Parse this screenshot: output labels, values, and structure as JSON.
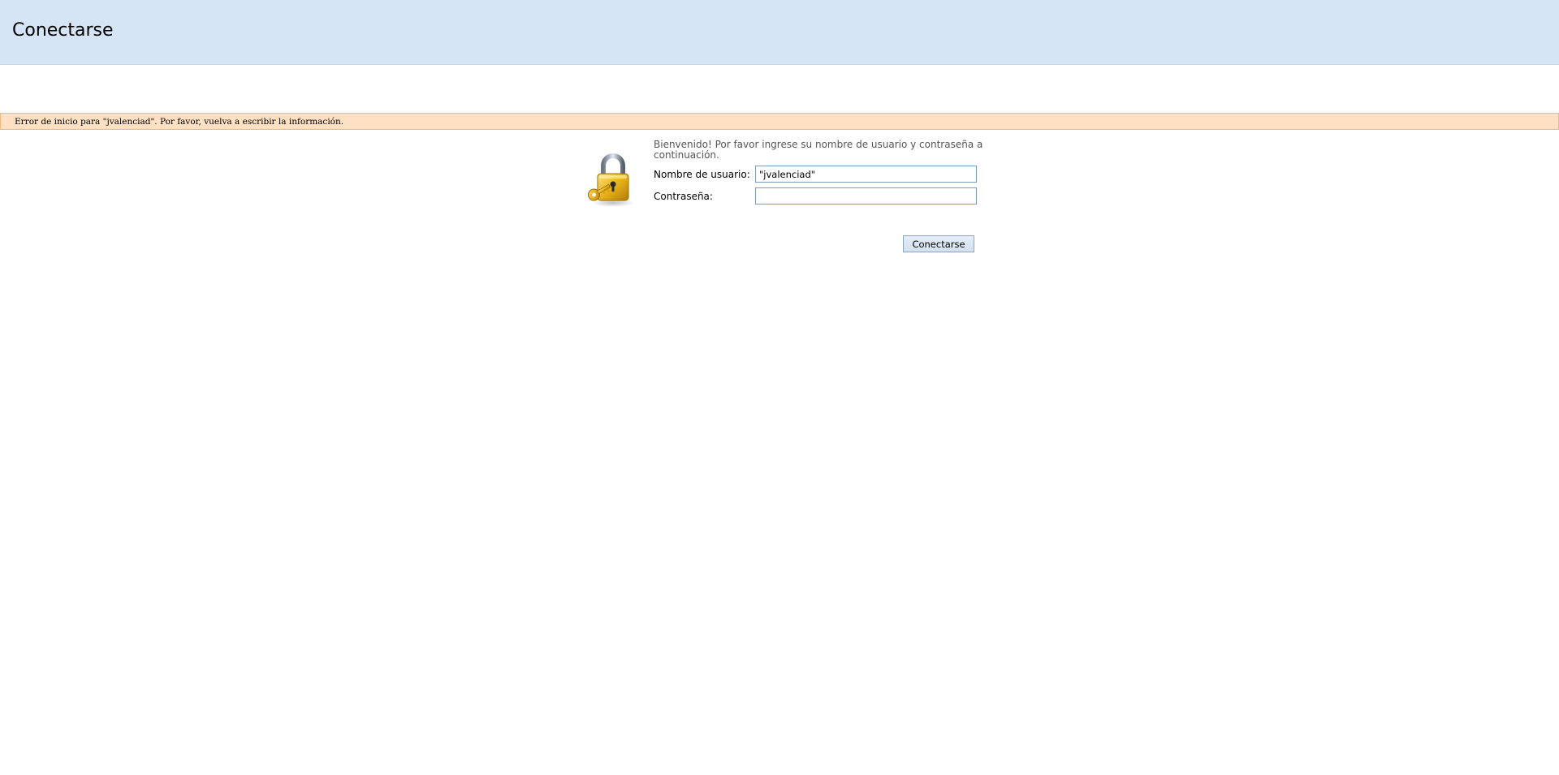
{
  "header": {
    "title": "Conectarse"
  },
  "error": {
    "message": "Error de inicio para \"jvalenciad\". Por favor, vuelva a escribir la información."
  },
  "login": {
    "welcome": "Bienvenido! Por favor ingrese su nombre de usuario y contraseña a continuación.",
    "username_label": "Nombre de usuario:",
    "username_value": "\"jvalenciad\"",
    "password_label": "Contraseña:",
    "password_value": "",
    "submit_label": "Conectarse",
    "icon": "lock-with-key-icon"
  },
  "colors": {
    "header_bg": "#d5e5f6",
    "error_bg": "#fee1c3",
    "error_border": "#f1b980",
    "lock_gold": "#e8b21a"
  }
}
